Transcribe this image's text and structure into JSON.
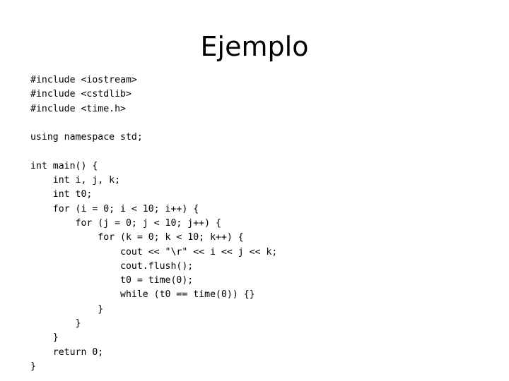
{
  "slide": {
    "title": "Ejemplo",
    "background_color": "#ffffff",
    "text_color": "#000000",
    "language": "cpp"
  },
  "code": {
    "lines": [
      "#include <iostream>",
      "#include <cstdlib>",
      "#include <time.h>",
      "",
      "using namespace std;",
      "",
      "int main() {",
      "    int i, j, k;",
      "    int t0;",
      "    for (i = 0; i < 10; i++) {",
      "        for (j = 0; j < 10; j++) {",
      "            for (k = 0; k < 10; k++) {",
      "                cout << \"\\r\" << i << j << k;",
      "                cout.flush();",
      "                t0 = time(0);",
      "                while (t0 == time(0)) {}",
      "            }",
      "        }",
      "    }",
      "    return 0;",
      "}"
    ]
  }
}
